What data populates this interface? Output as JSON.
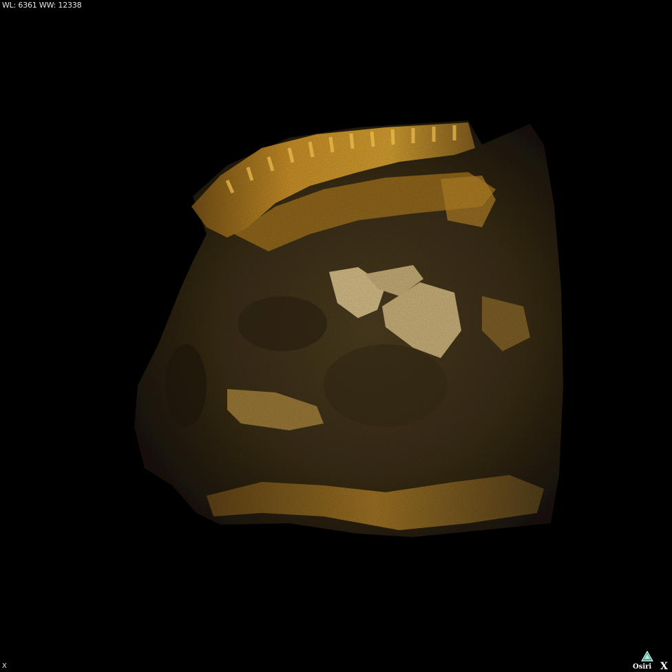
{
  "viewer": {
    "window_level_label": "WL: 6361 WW: 12338",
    "orientation_label": "X",
    "logo_text": "OsiriX"
  },
  "render": {
    "description_color_bone": "#d9a63a",
    "description_color_tissue": "#5a4620",
    "background": "#000000"
  }
}
